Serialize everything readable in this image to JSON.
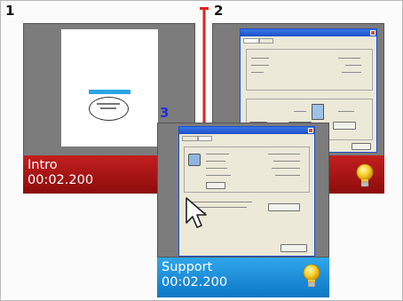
{
  "slides": [
    {
      "number": "1",
      "title": "Intro",
      "duration": "00:02.200"
    },
    {
      "number": "2",
      "title": "",
      "duration": ""
    },
    {
      "number": "3",
      "title": "Support",
      "duration": "00:02.200",
      "selected": true
    }
  ],
  "thumbnails": {
    "slide1_bubble": "",
    "slide1_circle": ""
  },
  "colors": {
    "intro_bar": "#a51616",
    "support_bar": "#1d8ad8",
    "selection_number": "#2030d8",
    "drag_indicator": "#e02020",
    "card_background": "#7c7c7c"
  },
  "icons": [
    "lightbulb-icon",
    "mouse-pointer-icon",
    "drag-insert-marker"
  ]
}
